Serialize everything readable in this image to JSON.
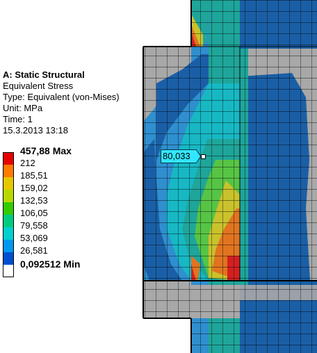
{
  "info": {
    "title": "A: Static Structural",
    "result": "Equivalent Stress",
    "type": "Type: Equivalent (von-Mises)",
    "unit": "Unit: MPa",
    "time": "Time: 1",
    "date": "15.3.2013 13:18"
  },
  "legend": {
    "bands": [
      {
        "label": "457,88 Max",
        "color": "#e60000"
      },
      {
        "label": "212",
        "color": "#ff7a00"
      },
      {
        "label": "185,51",
        "color": "#e6c800"
      },
      {
        "label": "159,02",
        "color": "#b8d800"
      },
      {
        "label": "132,53",
        "color": "#33cc00"
      },
      {
        "label": "106,05",
        "color": "#00cc80"
      },
      {
        "label": "79,558",
        "color": "#00d0d0"
      },
      {
        "label": "53,069",
        "color": "#0099ee"
      },
      {
        "label": "26,581",
        "color": "#0050d0"
      }
    ],
    "min_label": "0,092512 Min"
  },
  "probe": {
    "value": "80,033"
  },
  "colors": {
    "mesh_gray": "#a8a8a8",
    "deep_blue": "#1a5fa6",
    "mid_blue": "#2f8fcf",
    "teal": "#1fa59a",
    "cyan": "#17b8c4",
    "green": "#57c445",
    "yellow": "#c9c22c",
    "orange": "#e07420",
    "red": "#d42020"
  }
}
